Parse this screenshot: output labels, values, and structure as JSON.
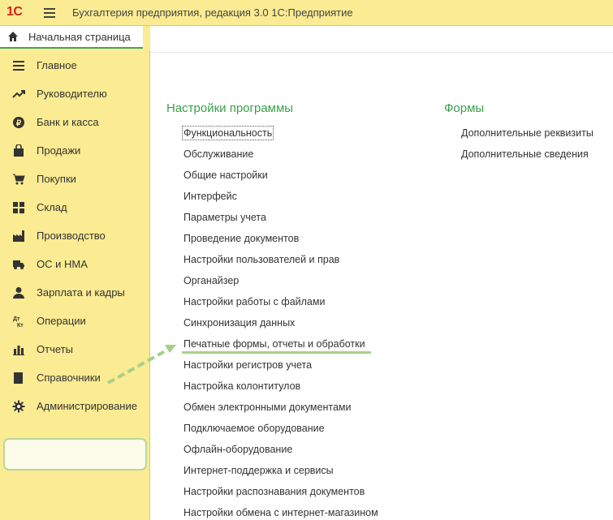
{
  "app": {
    "logo_text": "1С",
    "title": "Бухгалтерия предприятия, редакция 3.0 1С:Предприятие"
  },
  "home_tab": {
    "label": "Начальная страница",
    "icon": "home-icon"
  },
  "sidebar": {
    "items": [
      {
        "label": "Главное",
        "icon": "list-icon"
      },
      {
        "label": "Руководителю",
        "icon": "trend-icon"
      },
      {
        "label": "Банк и касса",
        "icon": "ruble-icon"
      },
      {
        "label": "Продажи",
        "icon": "bag-icon"
      },
      {
        "label": "Покупки",
        "icon": "cart-icon"
      },
      {
        "label": "Склад",
        "icon": "warehouse-icon"
      },
      {
        "label": "Производство",
        "icon": "factory-icon"
      },
      {
        "label": "ОС и НМА",
        "icon": "truck-icon"
      },
      {
        "label": "Зарплата и кадры",
        "icon": "person-icon"
      },
      {
        "label": "Операции",
        "icon": "debit-credit-icon"
      },
      {
        "label": "Отчеты",
        "icon": "bar-chart-icon"
      },
      {
        "label": "Справочники",
        "icon": "book-icon"
      },
      {
        "label": "Администрирование",
        "icon": "gear-icon"
      }
    ],
    "active_item": "Администрирование"
  },
  "main": {
    "settings_section": {
      "title": "Настройки программы",
      "links": [
        "Функциональность",
        "Обслуживание",
        "Общие настройки",
        "Интерфейс",
        "Параметры учета",
        "Проведение документов",
        "Настройки пользователей и прав",
        "Органайзер",
        "Настройки работы с файлами",
        "Синхронизация данных",
        "Печатные формы, отчеты и обработки",
        "Настройки регистров учета",
        "Настройка колонтитулов",
        "Обмен электронными документами",
        "Подключаемое оборудование",
        "Офлайн-оборудование",
        "Интернет-поддержка и сервисы",
        "Настройки распознавания документов",
        "Настройки обмена с интернет-магазином"
      ]
    },
    "forms_section": {
      "title": "Формы",
      "links": [
        "Дополнительные реквизиты",
        "Дополнительные сведения"
      ]
    }
  },
  "colors": {
    "sidebar_bg": "#fbeb92",
    "section_title": "#3aa049",
    "highlight": "#a8cf8a",
    "logo_red": "#d6231a"
  }
}
